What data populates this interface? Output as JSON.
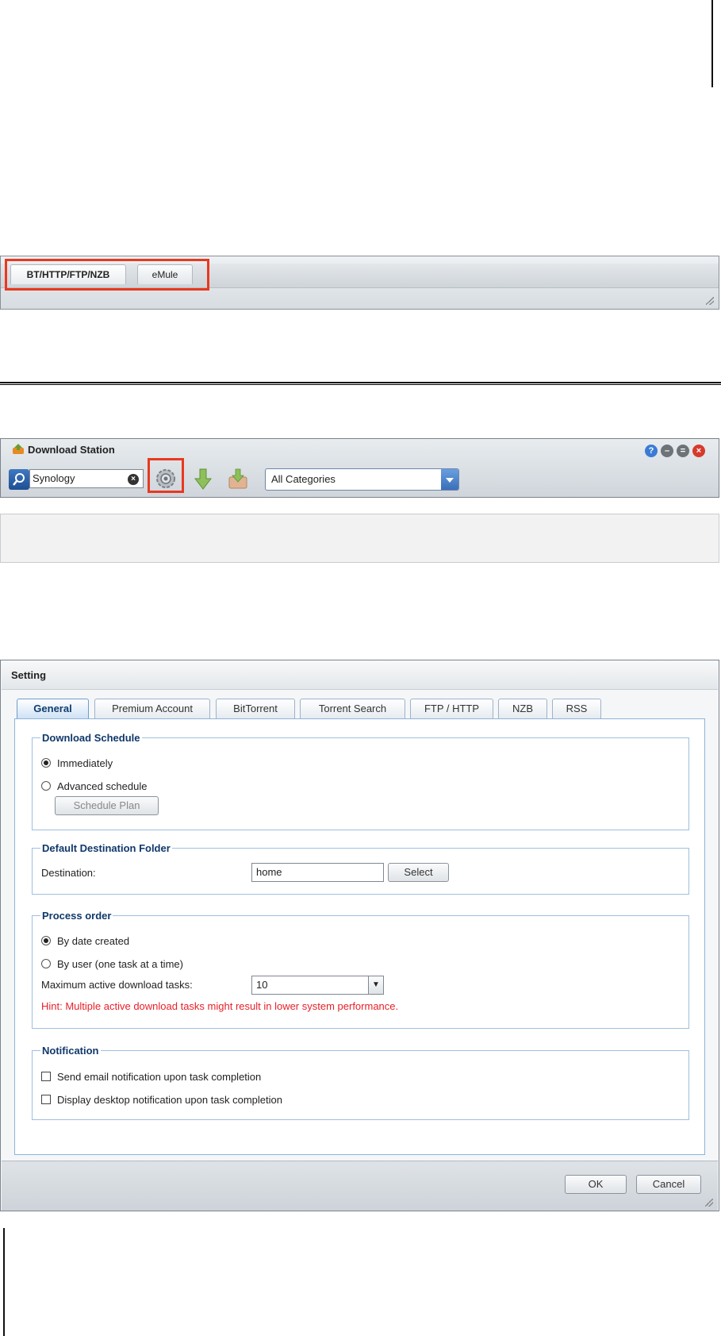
{
  "tabstrip": {
    "tabs": [
      {
        "label": "BT/HTTP/FTP/NZB",
        "active": true
      },
      {
        "label": "eMule",
        "active": false
      }
    ]
  },
  "download_station": {
    "title": "Download Station",
    "search_value": "Synology",
    "category_value": "All Categories",
    "icons": [
      "download-station-icon",
      "search-icon",
      "clear-icon",
      "gear-icon",
      "download-arrow-icon",
      "inbox-download-icon",
      "help-icon",
      "minimize-icon",
      "maximize-icon",
      "close-icon"
    ]
  },
  "dialog": {
    "title": "Setting",
    "tabs": [
      "General",
      "Premium Account",
      "BitTorrent",
      "Torrent Search",
      "FTP / HTTP",
      "NZB",
      "RSS"
    ],
    "active_tab": "General",
    "download_schedule": {
      "legend": "Download Schedule",
      "immediately": "Immediately",
      "advanced": "Advanced schedule",
      "schedule_plan_button": "Schedule Plan",
      "selected": "Immediately"
    },
    "destination": {
      "legend": "Default Destination Folder",
      "label": "Destination:",
      "value": "home",
      "select_button": "Select"
    },
    "process_order": {
      "legend": "Process order",
      "by_date": "By date created",
      "by_user": "By user (one task at a time)",
      "selected": "By date created",
      "max_label": "Maximum active download tasks:",
      "max_value": "10",
      "hint": "Hint: Multiple active download tasks might result in lower system performance."
    },
    "notification": {
      "legend": "Notification",
      "email": "Send email notification upon task completion",
      "desktop": "Display desktop notification upon task completion",
      "email_checked": false,
      "desktop_checked": false
    },
    "ok_button": "OK",
    "cancel_button": "Cancel"
  },
  "colors": {
    "highlight_red": "#e8391f",
    "legend_blue": "#10386a",
    "hint_red": "#e8202a"
  }
}
